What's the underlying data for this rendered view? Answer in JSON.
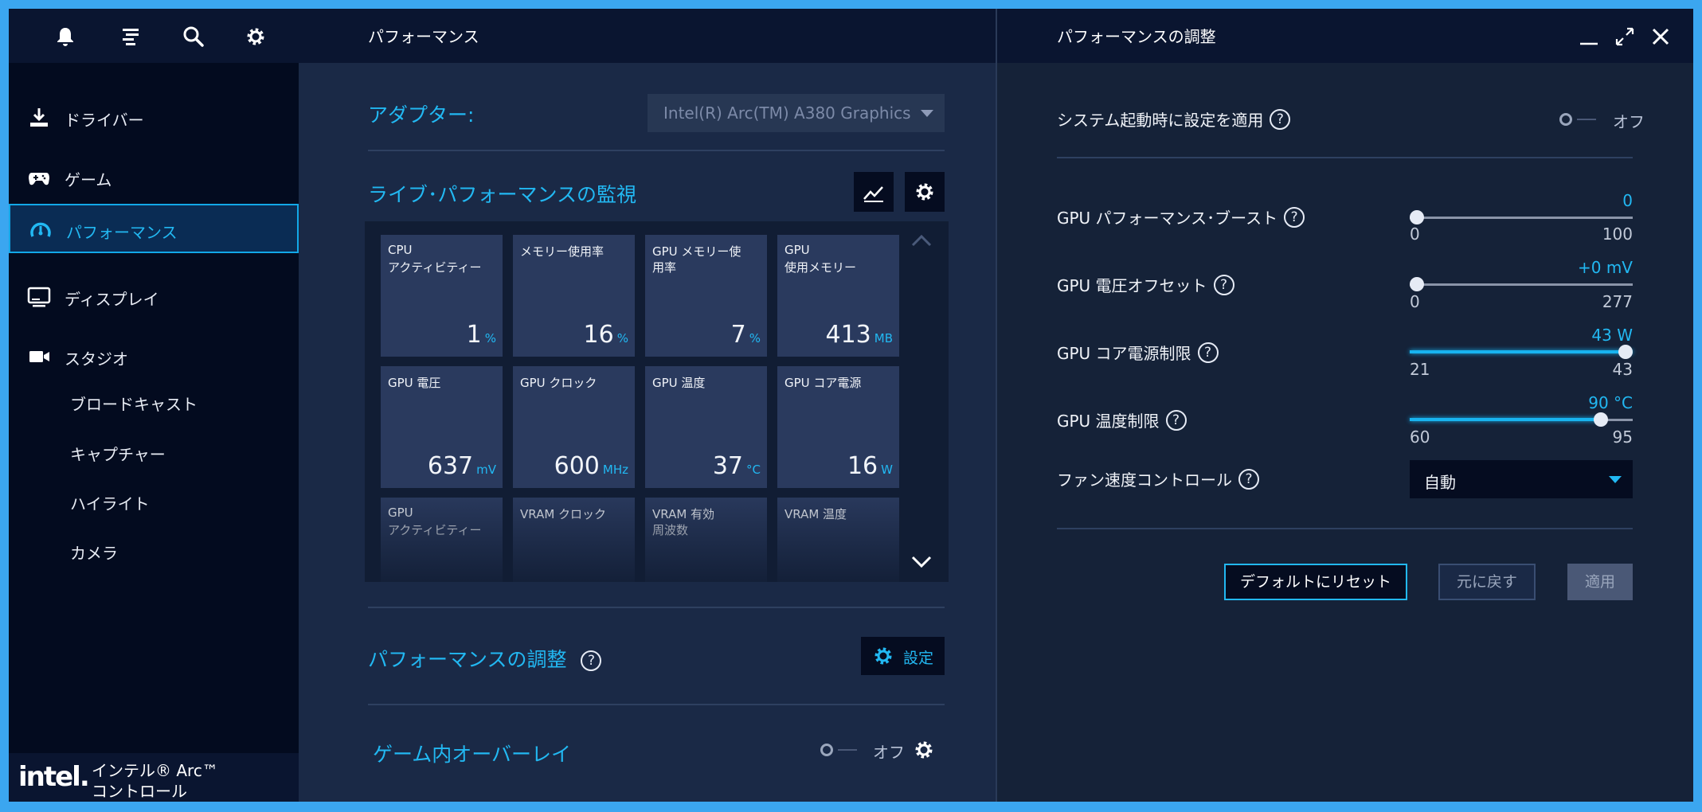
{
  "sidebar": {
    "nav": [
      {
        "label": "ドライバー",
        "icon": "download-icon"
      },
      {
        "label": "ゲーム",
        "icon": "gamepad-icon"
      },
      {
        "label": "パフォーマンス",
        "icon": "gauge-icon"
      },
      {
        "label": "ディスプレイ",
        "icon": "monitor-icon"
      },
      {
        "label": "スタジオ",
        "icon": "camera-icon"
      }
    ],
    "studio_sub": [
      "ブロードキャスト",
      "キャプチャー",
      "ハイライト",
      "カメラ"
    ],
    "active_index": 2,
    "brand": {
      "logo": "intel.",
      "name_line1": "インテル® Arc™",
      "name_line2": "コントロール"
    }
  },
  "middle": {
    "header_title": "パフォーマンス",
    "adapter_label": "アダプター:",
    "adapter_value": "Intel(R) Arc(TM) A380 Graphics",
    "live_monitor_title": "ライブ･パフォーマンスの監視",
    "tiles": [
      {
        "line1": "CPU",
        "line2": "アクティビティー",
        "value": "1",
        "unit": "%"
      },
      {
        "line1": "メモリー使用率",
        "line2": "",
        "value": "16",
        "unit": "%"
      },
      {
        "line1": "GPU メモリー使",
        "line2": "用率",
        "value": "7",
        "unit": "%"
      },
      {
        "line1": "GPU",
        "line2": "使用メモリー",
        "value": "413",
        "unit": "MB"
      },
      {
        "line1": "GPU 電圧",
        "line2": "",
        "value": "637",
        "unit": "mV"
      },
      {
        "line1": "GPU クロック",
        "line2": "",
        "value": "600",
        "unit": "MHz"
      },
      {
        "line1": "GPU 温度",
        "line2": "",
        "value": "37",
        "unit": "°C"
      },
      {
        "line1": "GPU コア電源",
        "line2": "",
        "value": "16",
        "unit": "W"
      },
      {
        "line1": "GPU",
        "line2": "アクティビティー",
        "value": "",
        "unit": ""
      },
      {
        "line1": "VRAM クロック",
        "line2": "",
        "value": "",
        "unit": ""
      },
      {
        "line1": "VRAM 有効",
        "line2": "周波数",
        "value": "",
        "unit": ""
      },
      {
        "line1": "VRAM 温度",
        "line2": "",
        "value": "",
        "unit": ""
      }
    ],
    "tuning_title": "パフォーマンスの調整",
    "settings_label": "設定",
    "overlay_title": "ゲーム内オーバーレイ",
    "overlay_state": "オフ"
  },
  "right": {
    "header_title": "パフォーマンスの調整",
    "apply_on_boot_label": "システム起動時に設定を適用",
    "apply_on_boot_state": "オフ",
    "sliders": [
      {
        "label": "GPU パフォーマンス･ブースト",
        "value": "0",
        "min": "0",
        "max": "100",
        "fraction": 0.0
      },
      {
        "label": "GPU 電圧オフセット",
        "value": "+0 mV",
        "min": "0",
        "max": "277",
        "fraction": 0.0
      },
      {
        "label": "GPU コア電源制限",
        "value": "43 W",
        "min": "21",
        "max": "43",
        "fraction": 1.0
      },
      {
        "label": "GPU 温度制限",
        "value": "90 °C",
        "min": "60",
        "max": "95",
        "fraction": 0.857
      }
    ],
    "fan_label": "ファン速度コントロール",
    "fan_value": "自動",
    "buttons": {
      "reset": "デフォルトにリセット",
      "revert": "元に戻す",
      "apply": "適用"
    }
  },
  "help_glyph": "?",
  "colors": {
    "accent": "#22b8f2",
    "frame": "#3ba6f0",
    "sidebar_bg": "#030b1f",
    "panel_bg": "#1a2946"
  }
}
